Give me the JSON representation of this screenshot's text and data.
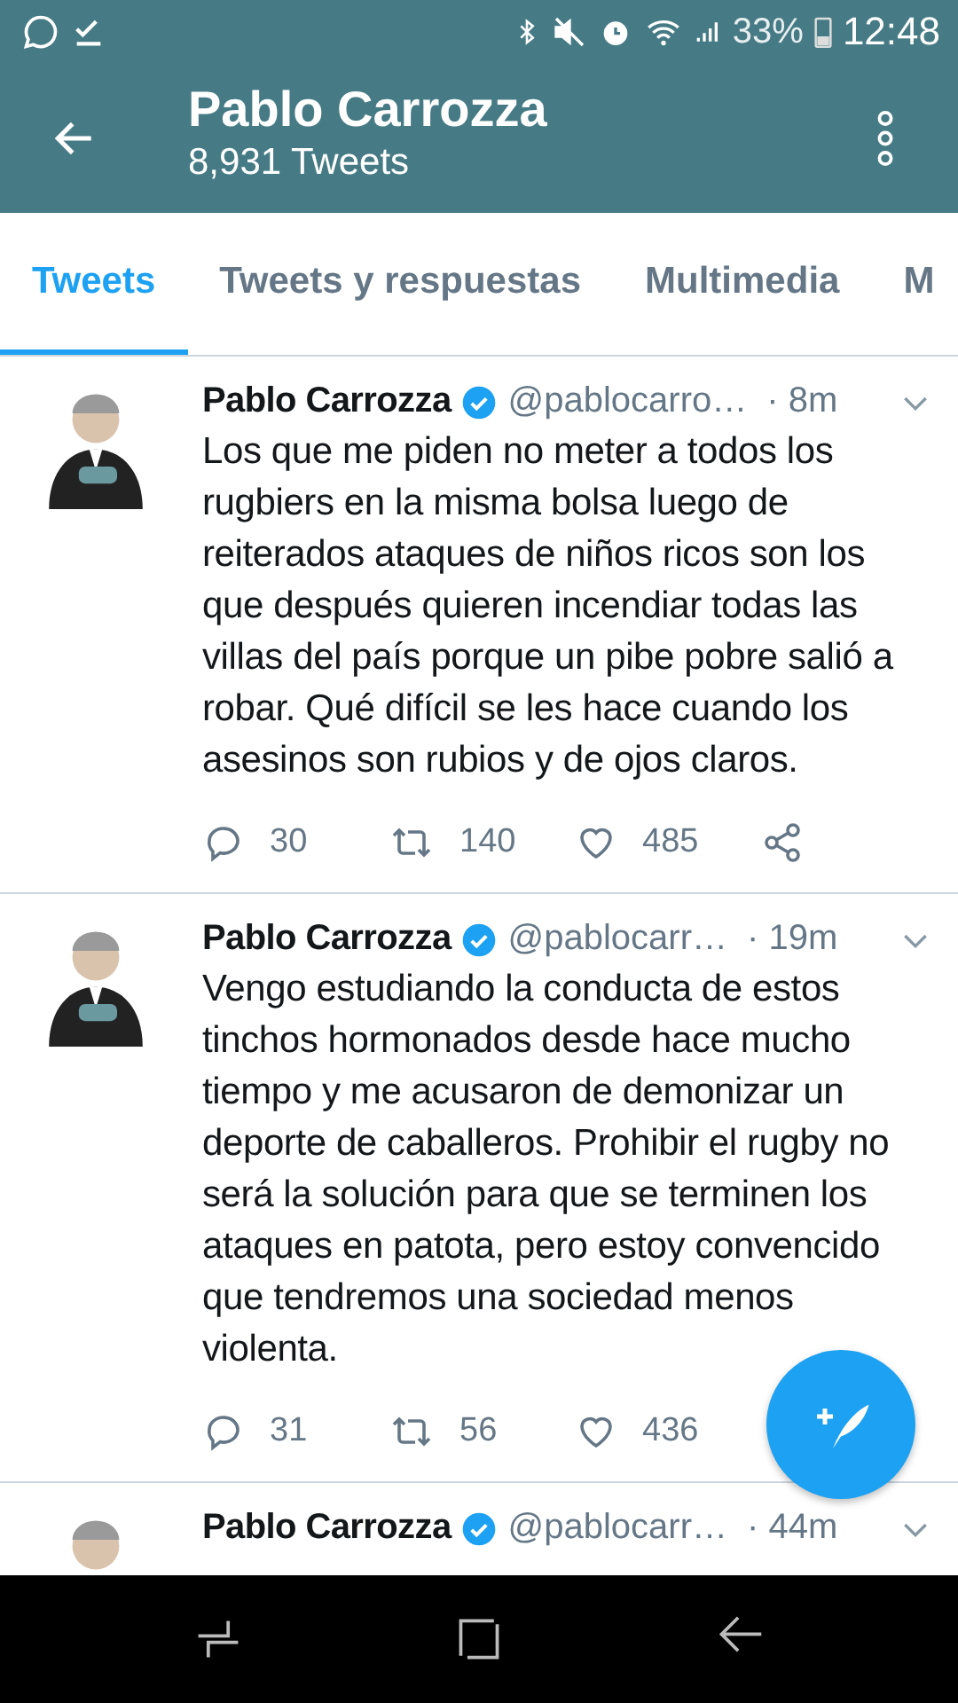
{
  "status_bar": {
    "battery": "33%",
    "time": "12:48"
  },
  "app_bar": {
    "title": "Pablo Carrozza",
    "subtitle": "8,931 Tweets"
  },
  "tabs": [
    {
      "label": "Tweets",
      "selected": true
    },
    {
      "label": "Tweets y respuestas",
      "selected": false
    },
    {
      "label": "Multimedia",
      "selected": false
    },
    {
      "label": "M",
      "selected": false
    }
  ],
  "tweets": [
    {
      "name": "Pablo Carrozza",
      "verified": true,
      "handle": "@pablocarro…",
      "time": "· 8m",
      "text": "Los que me piden no meter a todos los rugbiers en la misma bolsa luego de reiterados ataques de niños ricos son los que después quieren incendiar todas las villas del país porque un pibe pobre salió a robar. Qué difícil se les hace cuando los asesinos son rubios y de ojos claros.",
      "actions": [
        {
          "kind": "reply",
          "count": "30"
        },
        {
          "kind": "retweet",
          "count": "140"
        },
        {
          "kind": "like",
          "count": "485"
        },
        {
          "kind": "share"
        }
      ]
    },
    {
      "name": "Pablo Carrozza",
      "verified": true,
      "handle": "@pablocarr…",
      "time": "· 19m",
      "text": "Vengo estudiando la conducta de estos tinchos hormonados desde hace mucho tiempo y me acusaron de demonizar un deporte de caballeros. Prohibir el rugby no será la solución para que se terminen los ataques en patota, pero estoy convencido que tendremos una sociedad menos violenta.",
      "actions": [
        {
          "kind": "reply",
          "count": "31"
        },
        {
          "kind": "retweet",
          "count": "56"
        },
        {
          "kind": "like",
          "count": "436"
        }
      ]
    },
    {
      "name": "Pablo Carrozza",
      "verified": true,
      "handle": "@pablocarr…",
      "time": "· 44m"
    }
  ]
}
